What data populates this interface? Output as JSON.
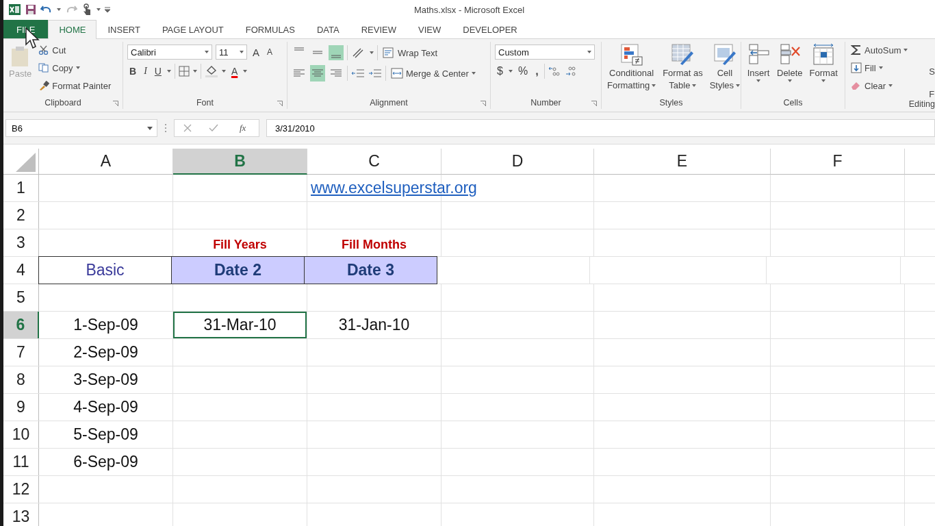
{
  "window": {
    "title": "Maths.xlsx - Microsoft Excel"
  },
  "tabs": [
    {
      "label": "FILE",
      "kind": "file",
      "selected": false
    },
    {
      "label": "HOME",
      "kind": "tab",
      "selected": true
    },
    {
      "label": "INSERT",
      "kind": "tab",
      "selected": false
    },
    {
      "label": "PAGE LAYOUT",
      "kind": "tab",
      "selected": false
    },
    {
      "label": "FORMULAS",
      "kind": "tab",
      "selected": false
    },
    {
      "label": "DATA",
      "kind": "tab",
      "selected": false
    },
    {
      "label": "REVIEW",
      "kind": "tab",
      "selected": false
    },
    {
      "label": "VIEW",
      "kind": "tab",
      "selected": false
    },
    {
      "label": "DEVELOPER",
      "kind": "tab",
      "selected": false
    }
  ],
  "clipboard": {
    "paste": "Paste",
    "paste_disabled": true,
    "cut": "Cut",
    "copy": "Copy",
    "format_painter": "Format Painter",
    "label": "Clipboard"
  },
  "font": {
    "name": "Calibri",
    "size": "11",
    "grow": "A",
    "shrink": "A",
    "styles": [
      {
        "label": "B",
        "kind": "bold"
      },
      {
        "label": "I",
        "kind": "italic"
      },
      {
        "label": "U",
        "kind": "underline"
      }
    ],
    "font_color": "A",
    "label": "Font"
  },
  "alignment": {
    "vertical": [
      {
        "kind": "top",
        "selected": false
      },
      {
        "kind": "middle",
        "selected": false
      },
      {
        "kind": "bottom",
        "selected": true
      }
    ],
    "horizontal": [
      {
        "kind": "left",
        "selected": false
      },
      {
        "kind": "center",
        "selected": true
      },
      {
        "kind": "right",
        "selected": false
      }
    ],
    "wrap_text": "Wrap Text",
    "merge_center": "Merge & Center",
    "label": "Alignment"
  },
  "number": {
    "format": "Custom",
    "currency": "$",
    "percent": "%",
    "comma": ",",
    "label": "Number"
  },
  "styles": {
    "buttons": [
      {
        "line1": "Conditional",
        "line2": "Formatting",
        "kind": "conditional"
      },
      {
        "line1": "Format as",
        "line2": "Table",
        "kind": "table"
      },
      {
        "line1": "Cell",
        "line2": "Styles",
        "kind": "cellstyles"
      }
    ],
    "label": "Styles"
  },
  "cells": {
    "buttons": [
      {
        "label": "Insert",
        "kind": "insert"
      },
      {
        "label": "Delete",
        "kind": "delete"
      },
      {
        "label": "Format",
        "kind": "format"
      }
    ],
    "label": "Cells"
  },
  "editing": {
    "autosum": "AutoSum",
    "fill": "Fill",
    "clear": "Clear",
    "cut_text_1": "S",
    "cut_text_2": "F",
    "label": "Editing"
  },
  "formula_bar": {
    "name_box": "B6",
    "fx": "fx",
    "value": "3/31/2010"
  },
  "columns": [
    {
      "label": "A",
      "selected": false
    },
    {
      "label": "B",
      "selected": true
    },
    {
      "label": "C",
      "selected": false
    },
    {
      "label": "D",
      "selected": false
    },
    {
      "label": "E",
      "selected": false
    },
    {
      "label": "F",
      "selected": false
    }
  ],
  "rows": [
    {
      "label": "1",
      "selected": false,
      "cells": [
        {},
        {},
        {
          "text": "www.excelsuperstar.org",
          "kind": "link"
        },
        {},
        {},
        {}
      ]
    },
    {
      "label": "2",
      "selected": false,
      "cells": [
        {},
        {},
        {},
        {},
        {},
        {}
      ]
    },
    {
      "label": "3",
      "selected": false,
      "cells": [
        {},
        {
          "text": "Fill Years",
          "kind": "note"
        },
        {
          "text": "Fill Months",
          "kind": "note"
        },
        {},
        {},
        {}
      ]
    },
    {
      "label": "4",
      "selected": false,
      "cells": [
        {
          "text": "Basic",
          "kind": "label"
        },
        {
          "text": "Date 2",
          "kind": "band"
        },
        {
          "text": "Date 3",
          "kind": "band"
        },
        {},
        {},
        {}
      ]
    },
    {
      "label": "5",
      "selected": false,
      "cells": [
        {},
        {},
        {},
        {},
        {},
        {}
      ]
    },
    {
      "label": "6",
      "selected": true,
      "cells": [
        {
          "text": "1-Sep-09",
          "kind": "value"
        },
        {
          "text": "31-Mar-10",
          "kind": "value",
          "selected": true
        },
        {
          "text": "31-Jan-10",
          "kind": "value"
        },
        {},
        {},
        {}
      ]
    },
    {
      "label": "7",
      "selected": false,
      "cells": [
        {
          "text": "2-Sep-09",
          "kind": "value"
        },
        {},
        {},
        {},
        {},
        {}
      ]
    },
    {
      "label": "8",
      "selected": false,
      "cells": [
        {
          "text": "3-Sep-09",
          "kind": "value"
        },
        {},
        {},
        {},
        {},
        {}
      ]
    },
    {
      "label": "9",
      "selected": false,
      "cells": [
        {
          "text": "4-Sep-09",
          "kind": "value"
        },
        {},
        {},
        {},
        {},
        {}
      ]
    },
    {
      "label": "10",
      "selected": false,
      "cells": [
        {
          "text": "5-Sep-09",
          "kind": "value"
        },
        {},
        {},
        {},
        {},
        {}
      ]
    },
    {
      "label": "11",
      "selected": false,
      "cells": [
        {
          "text": "6-Sep-09",
          "kind": "value"
        },
        {},
        {},
        {},
        {},
        {}
      ]
    },
    {
      "label": "12",
      "selected": false,
      "cells": [
        {},
        {},
        {},
        {},
        {},
        {}
      ]
    },
    {
      "label": "13",
      "selected": false,
      "cells": [
        {},
        {},
        {},
        {},
        {},
        {}
      ]
    }
  ]
}
